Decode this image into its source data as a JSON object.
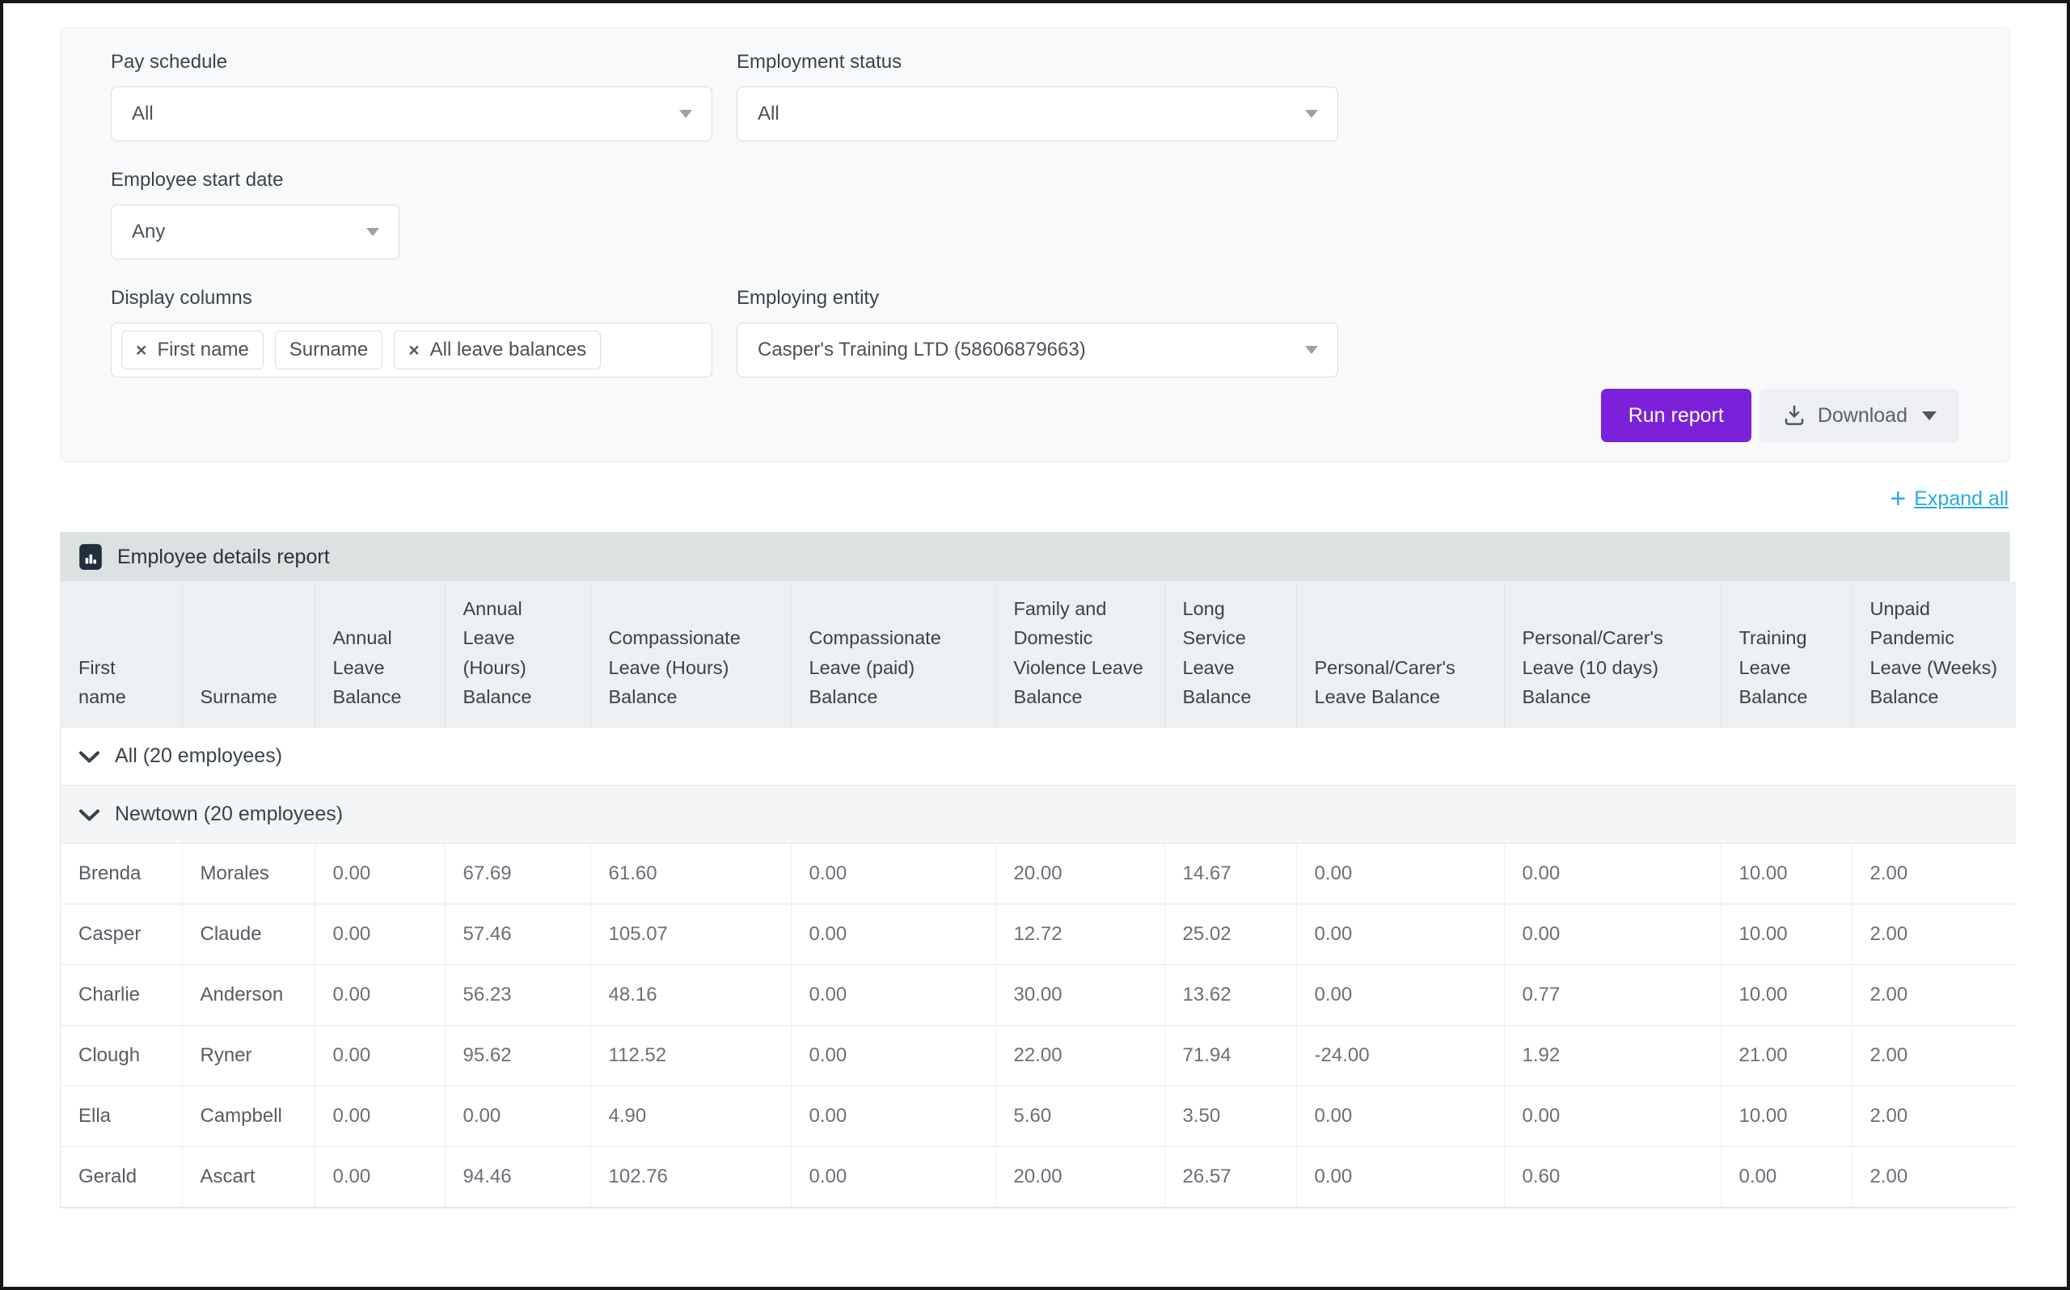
{
  "filters": {
    "pay_schedule": {
      "label": "Pay schedule",
      "value": "All"
    },
    "employment_status": {
      "label": "Employment status",
      "value": "All"
    },
    "employee_start_date": {
      "label": "Employee start date",
      "value": "Any"
    },
    "display_columns": {
      "label": "Display columns",
      "tags": [
        {
          "label": "First name",
          "removable": true
        },
        {
          "label": "Surname",
          "removable": false
        },
        {
          "label": "All leave balances",
          "removable": true
        }
      ]
    },
    "employing_entity": {
      "label": "Employing entity",
      "value": "Casper's Training LTD (58606879663)"
    }
  },
  "actions": {
    "run_report_label": "Run report",
    "download_label": "Download",
    "expand_all_label": "Expand all"
  },
  "icons": {
    "remove_tag": "×",
    "expand_plus": "+"
  },
  "colors": {
    "primary_purple": "#7c21da",
    "link_blue": "#2aabe2",
    "title_bar_bg": "#dce2e2",
    "header_bg": "#edf0f3"
  },
  "report": {
    "title": "Employee details report",
    "columns": [
      "First name",
      "Surname",
      "Annual Leave Balance",
      "Annual Leave (Hours) Balance",
      "Compassionate Leave (Hours) Balance",
      "Compassionate Leave (paid) Balance",
      "Family and Domestic Violence Leave Balance",
      "Long Service Leave Balance",
      "Personal/Carer's Leave Balance",
      "Personal/Carer's Leave (10 days) Balance",
      "Training Leave Balance",
      "Unpaid Pandemic Leave (Weeks) Balance"
    ],
    "groups": [
      {
        "label": "All (20 employees)",
        "rows": []
      },
      {
        "label": "Newtown (20 employees)",
        "rows": [
          [
            "Brenda",
            "Morales",
            "0.00",
            "67.69",
            "61.60",
            "0.00",
            "20.00",
            "14.67",
            "0.00",
            "0.00",
            "10.00",
            "2.00"
          ],
          [
            "Casper",
            "Claude",
            "0.00",
            "57.46",
            "105.07",
            "0.00",
            "12.72",
            "25.02",
            "0.00",
            "0.00",
            "10.00",
            "2.00"
          ],
          [
            "Charlie",
            "Anderson",
            "0.00",
            "56.23",
            "48.16",
            "0.00",
            "30.00",
            "13.62",
            "0.00",
            "0.77",
            "10.00",
            "2.00"
          ],
          [
            "Clough",
            "Ryner",
            "0.00",
            "95.62",
            "112.52",
            "0.00",
            "22.00",
            "71.94",
            "-24.00",
            "1.92",
            "21.00",
            "2.00"
          ],
          [
            "Ella",
            "Campbell",
            "0.00",
            "0.00",
            "4.90",
            "0.00",
            "5.60",
            "3.50",
            "0.00",
            "0.00",
            "10.00",
            "2.00"
          ],
          [
            "Gerald",
            "Ascart",
            "0.00",
            "94.46",
            "102.76",
            "0.00",
            "20.00",
            "26.57",
            "0.00",
            "0.60",
            "0.00",
            "2.00"
          ]
        ]
      }
    ]
  }
}
